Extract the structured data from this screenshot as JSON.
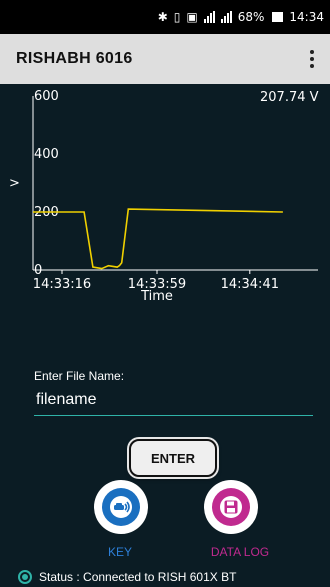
{
  "status_bar": {
    "bluetooth_icon": "bluetooth-icon",
    "battery_text": "68%",
    "time": "14:34"
  },
  "app_bar": {
    "title": "RISHABH 6016",
    "overflow_icon": "more-vert-icon"
  },
  "chart_data": {
    "type": "line",
    "readout": "207.74 V",
    "xlabel": "Time",
    "ylabel": ">",
    "ylim": [
      0,
      600
    ],
    "yticks": [
      "600",
      "400",
      "200",
      "0"
    ],
    "xticks": [
      "14:33:16",
      "14:33:59",
      "14:34:41"
    ],
    "series": [
      {
        "color": "#f0d000",
        "x_seconds_from_first_tick": [
          -18,
          10,
          14,
          18,
          21,
          25,
          26,
          27,
          30,
          100
        ],
        "values": [
          200,
          200,
          10,
          5,
          15,
          10,
          15,
          25,
          210,
          200
        ]
      }
    ]
  },
  "form": {
    "label": "Enter File Name:",
    "value": "filename",
    "enter_label": "ENTER"
  },
  "actions": {
    "key_label": "KEY",
    "log_label": "DATA LOG",
    "key_color": "#1a6fc0",
    "log_color": "#c02a8f"
  },
  "status": {
    "text": "Status : Connected to RISH 601X BT"
  }
}
